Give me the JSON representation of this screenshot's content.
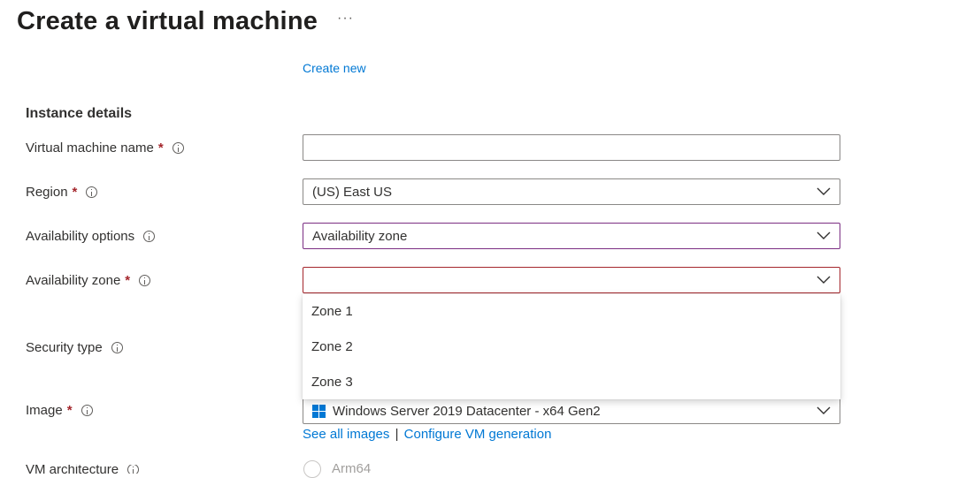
{
  "header": {
    "title": "Create a virtual machine",
    "more_label": "···"
  },
  "link_create_new": "Create new",
  "section_title": "Instance details",
  "fields": {
    "vm_name": {
      "label": "Virtual machine name",
      "value": ""
    },
    "region": {
      "label": "Region",
      "value": "(US) East US"
    },
    "availability_options": {
      "label": "Availability options",
      "value": "Availability zone"
    },
    "availability_zone": {
      "label": "Availability zone",
      "value": "",
      "options": [
        "Zone 1",
        "Zone 2",
        "Zone 3"
      ]
    },
    "security_type": {
      "label": "Security type"
    },
    "image": {
      "label": "Image",
      "value": "Windows Server 2019 Datacenter - x64 Gen2"
    },
    "vm_architecture": {
      "label": "VM architecture",
      "option": "Arm64"
    }
  },
  "image_links": {
    "see_all": "See all images",
    "separator": "|",
    "configure": "Configure VM generation"
  },
  "required_marker": "*",
  "colors": {
    "link": "#0078d4",
    "required": "#a4262c",
    "focus_border": "#7b2e83"
  }
}
